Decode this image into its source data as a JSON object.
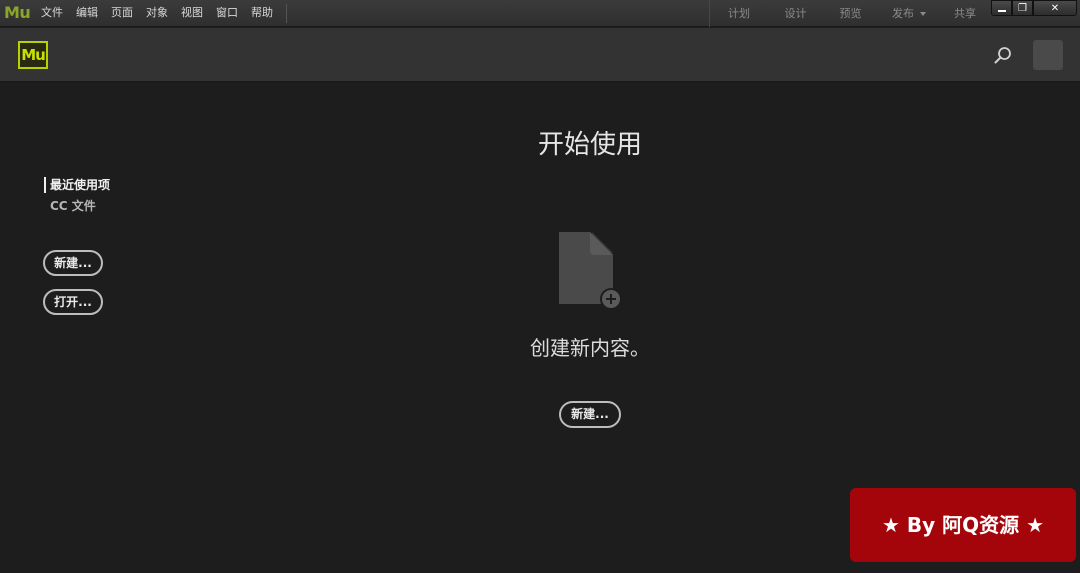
{
  "app": {
    "logo_small": "Mu",
    "logo_header": "Mu"
  },
  "menu": [
    "文件",
    "编辑",
    "页面",
    "对象",
    "视图",
    "窗口",
    "帮助"
  ],
  "modes": [
    {
      "label": "计划"
    },
    {
      "label": "设计"
    },
    {
      "label": "预览"
    },
    {
      "label": "发布"
    },
    {
      "label": "共享"
    }
  ],
  "window_controls": {
    "max_glyph": "❐",
    "close_glyph": "✕"
  },
  "header": {
    "search_icon": "search-icon",
    "avatar": "account-avatar"
  },
  "sidebar": {
    "tabs": [
      {
        "label": "最近使用项",
        "active": true
      },
      {
        "label": "CC 文件",
        "active": false
      }
    ],
    "new_label": "新建...",
    "open_label": "打开..."
  },
  "main": {
    "title": "开始使用",
    "empty_icon": "new-document-icon",
    "empty_text": "创建新内容。",
    "new_label": "新建..."
  },
  "watermark": {
    "text": "★ By 阿Q资源 ★"
  },
  "colors": {
    "accent": "#b8d200",
    "watermark_bg": "#a4050b",
    "background": "#1d1d1d"
  }
}
